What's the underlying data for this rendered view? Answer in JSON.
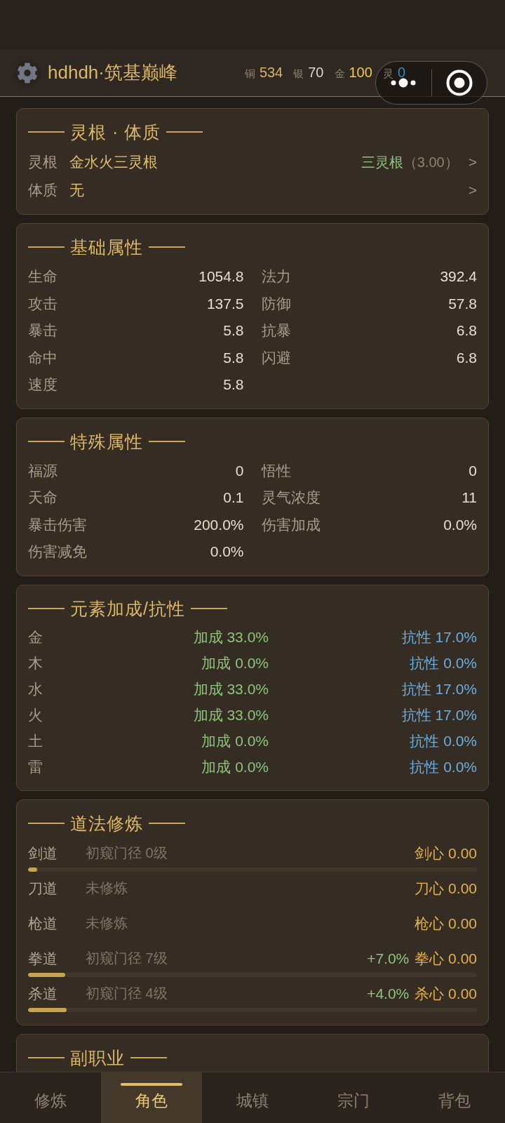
{
  "header": {
    "title": "hdhdh·筑基巅峰",
    "currencies": [
      {
        "label": "铜",
        "value": "534",
        "color": "#d9b36a"
      },
      {
        "label": "银",
        "value": "70",
        "color": "#d8d4cc"
      },
      {
        "label": "金",
        "value": "100",
        "color": "#f2c94c"
      },
      {
        "label": "灵",
        "value": "0",
        "color": "#3f86b8"
      }
    ]
  },
  "root_card": {
    "title": "灵根 · 体质",
    "rows": [
      {
        "label": "灵根",
        "value": "金水火三灵根",
        "grade": "三灵根",
        "score": "（3.00）",
        "arrow": ">"
      },
      {
        "label": "体质",
        "value": "无",
        "arrow": ">"
      }
    ]
  },
  "base_stats": {
    "title": "基础属性",
    "items": [
      {
        "label": "生命",
        "value": "1054.8"
      },
      {
        "label": "法力",
        "value": "392.4"
      },
      {
        "label": "攻击",
        "value": "137.5"
      },
      {
        "label": "防御",
        "value": "57.8"
      },
      {
        "label": "暴击",
        "value": "5.8"
      },
      {
        "label": "抗暴",
        "value": "6.8"
      },
      {
        "label": "命中",
        "value": "5.8"
      },
      {
        "label": "闪避",
        "value": "6.8"
      },
      {
        "label": "速度",
        "value": "5.8"
      }
    ]
  },
  "special_stats": {
    "title": "特殊属性",
    "items": [
      {
        "label": "福源",
        "value": "0"
      },
      {
        "label": "悟性",
        "value": "0"
      },
      {
        "label": "天命",
        "value": "0.1"
      },
      {
        "label": "灵气浓度",
        "value": "11"
      },
      {
        "label": "暴击伤害",
        "value": "200.0%"
      },
      {
        "label": "伤害加成",
        "value": "0.0%"
      },
      {
        "label": "伤害减免",
        "value": "0.0%"
      }
    ]
  },
  "elements": {
    "title": "元素加成/抗性",
    "rows": [
      {
        "element": "金",
        "bonus": "加成 33.0%",
        "resist": "抗性 17.0%"
      },
      {
        "element": "木",
        "bonus": "加成 0.0%",
        "resist": "抗性 0.0%"
      },
      {
        "element": "水",
        "bonus": "加成 33.0%",
        "resist": "抗性 17.0%"
      },
      {
        "element": "火",
        "bonus": "加成 33.0%",
        "resist": "抗性 17.0%"
      },
      {
        "element": "土",
        "bonus": "加成 0.0%",
        "resist": "抗性 0.0%"
      },
      {
        "element": "雷",
        "bonus": "加成 0.0%",
        "resist": "抗性 0.0%"
      }
    ]
  },
  "dao": {
    "title": "道法修炼",
    "rows": [
      {
        "name": "剑道",
        "stage": "初窥门径 0级",
        "heart": "剑心 0.00",
        "level": 0.02
      },
      {
        "name": "刀道",
        "stage": "未修炼",
        "heart": "刀心 0.00"
      },
      {
        "name": "枪道",
        "stage": "未修炼",
        "heart": "枪心 0.00"
      },
      {
        "name": "拳道",
        "stage": "初窥门径 7级",
        "bonus": "+7.0%",
        "heart": "拳心 0.00",
        "level": 0.083
      },
      {
        "name": "杀道",
        "stage": "初窥门径 4级",
        "bonus": "+4.0%",
        "heart": "杀心 0.00",
        "level": 0.086
      }
    ]
  },
  "side_job": {
    "title": "副职业"
  },
  "tabs": [
    {
      "label": "修炼",
      "selected": false
    },
    {
      "label": "角色",
      "selected": true
    },
    {
      "label": "城镇",
      "selected": false
    },
    {
      "label": "宗门",
      "selected": false
    },
    {
      "label": "背包",
      "selected": false
    }
  ]
}
